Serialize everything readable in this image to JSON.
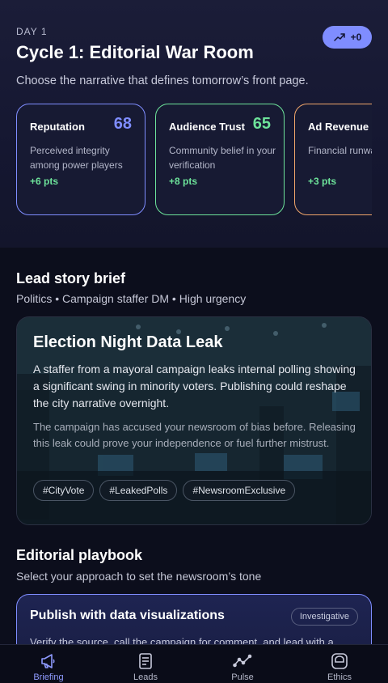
{
  "header": {
    "day_label": "DAY 1",
    "title": "Cycle 1: Editorial War Room",
    "badge": "+0",
    "subtitle": "Choose the narrative that defines tomorrow’s front page."
  },
  "metrics": [
    {
      "name": "Reputation",
      "value": "68",
      "description": "Perceived integrity among power players",
      "delta": "+6 pts",
      "color": "#7f8dff"
    },
    {
      "name": "Audience Trust",
      "value": "65",
      "description": "Community belief in your verification",
      "delta": "+8 pts",
      "color": "#6de39a"
    },
    {
      "name": "Ad Revenue",
      "value": "",
      "description": "Financial runway for bold reporting",
      "delta": "+3 pts",
      "color": "#f0a56a"
    }
  ],
  "lead": {
    "title": "Lead story brief",
    "meta": "Politics • Campaign staffer DM • High urgency",
    "story_title": "Election Night Data Leak",
    "story_body": "A staffer from a mayoral campaign leaks internal polling showing a significant swing in minority voters. Publishing could reshape the city narrative overnight.",
    "story_note": "The campaign has accused your newsroom of bias before. Releasing this leak could prove your independence or fuel further mistrust.",
    "tags": [
      "#CityVote",
      "#LeakedPolls",
      "#NewsroomExclusive"
    ]
  },
  "playbook": {
    "title": "Editorial playbook",
    "subtitle": "Select your approach to set the newsroom’s tone",
    "option_title": "Publish with data visualizations",
    "option_tag": "Investigative",
    "option_desc": "Verify the source, call the campaign for comment, and lead with a"
  },
  "tabs": [
    {
      "label": "Briefing",
      "icon": "megaphone-icon",
      "active": true
    },
    {
      "label": "Leads",
      "icon": "document-icon",
      "active": false
    },
    {
      "label": "Pulse",
      "icon": "pulse-chart-icon",
      "active": false
    },
    {
      "label": "Ethics",
      "icon": "ethics-badge-icon",
      "active": false
    }
  ]
}
